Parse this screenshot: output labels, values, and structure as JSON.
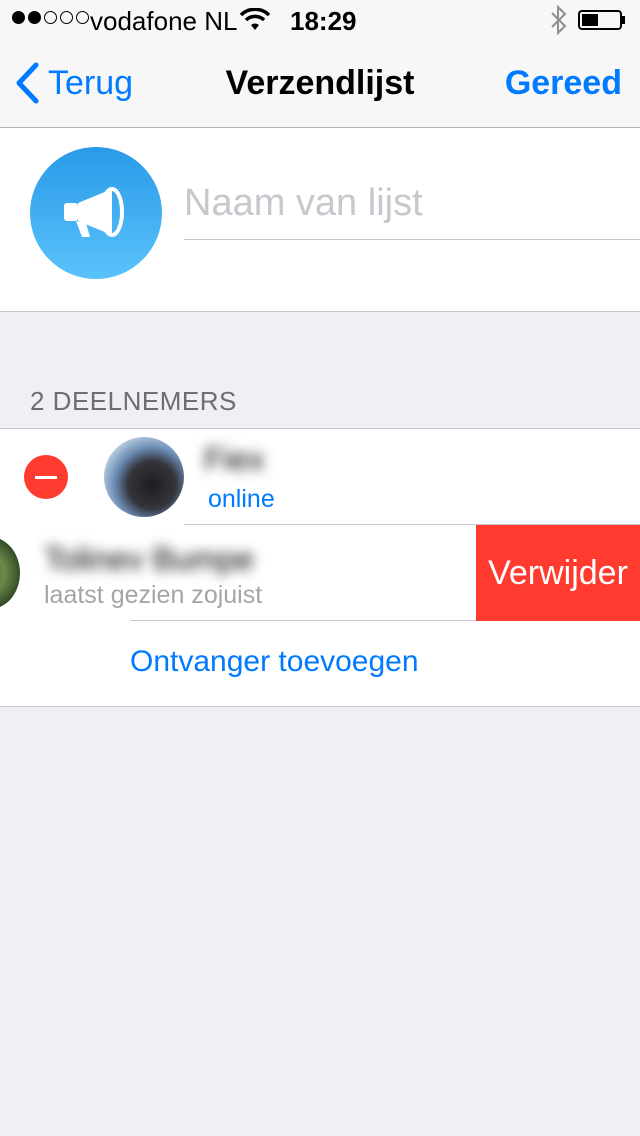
{
  "status_bar": {
    "carrier": "vodafone NL",
    "time": "18:29",
    "signal_bars_filled": 2,
    "signal_bars_total": 5
  },
  "nav": {
    "back_label": "Terug",
    "title": "Verzendlijst",
    "done_label": "Gereed"
  },
  "list_name": {
    "placeholder": "Naam van lijst",
    "value": ""
  },
  "participants": {
    "header": "2 DEELNEMERS",
    "items": [
      {
        "name": "Fiex",
        "status": "online"
      },
      {
        "name": "Tolinev Bumpe",
        "status": "laatst gezien zojuist"
      }
    ],
    "delete_label": "Verwijder",
    "add_label": "Ontvanger toevoegen"
  },
  "colors": {
    "accent": "#007aff",
    "destructive": "#ff3b30",
    "background": "#efeff4"
  },
  "icons": {
    "list_avatar": "megaphone-icon",
    "back": "chevron-left-icon",
    "wifi": "wifi-icon",
    "bluetooth": "bluetooth-icon",
    "battery": "battery-icon"
  }
}
